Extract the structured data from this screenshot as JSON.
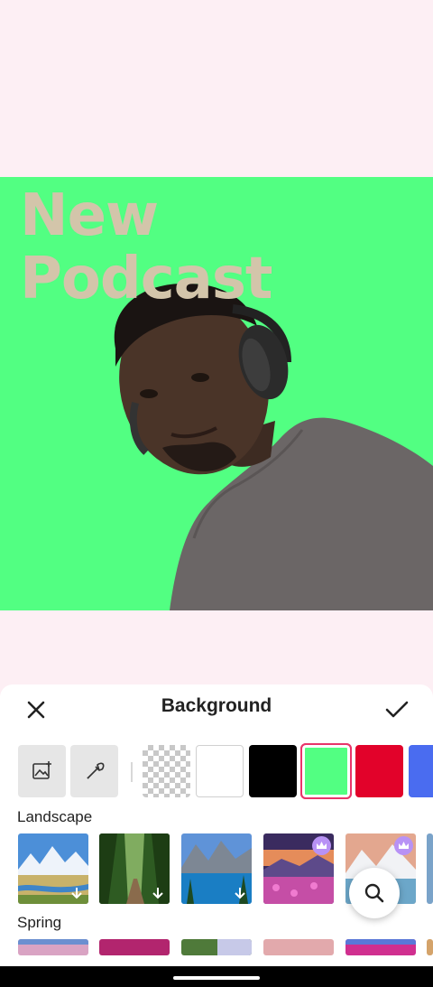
{
  "canvas": {
    "background_color": "#fdeff4",
    "poster": {
      "background_color": "#52ff82",
      "title_lines": [
        "New",
        "Podcast"
      ],
      "title_color": "#d3c5aa"
    }
  },
  "panel": {
    "title": "Background",
    "close_icon": "close-icon",
    "confirm_icon": "checkmark-icon",
    "tools": [
      {
        "name": "add-image",
        "icon": "image-add-icon"
      },
      {
        "name": "eyedropper",
        "icon": "eyedropper-icon"
      }
    ],
    "colors": [
      {
        "name": "transparent",
        "value": "transparent"
      },
      {
        "name": "white",
        "value": "#ffffff"
      },
      {
        "name": "black",
        "value": "#000000"
      },
      {
        "name": "green",
        "value": "#52ff82",
        "selected": true
      },
      {
        "name": "red",
        "value": "#e2022a"
      },
      {
        "name": "blue",
        "value": "#4a6cf0"
      }
    ],
    "sections": [
      {
        "label": "Landscape",
        "items": [
          {
            "badge": "download"
          },
          {
            "badge": "download"
          },
          {
            "badge": "download"
          },
          {
            "badge": "premium-crown"
          },
          {
            "badge": "premium-crown"
          }
        ]
      },
      {
        "label": "Spring",
        "items": [
          {},
          {},
          {},
          {},
          {}
        ]
      }
    ],
    "search_icon": "search-icon",
    "accent_color": "#e8356a"
  }
}
